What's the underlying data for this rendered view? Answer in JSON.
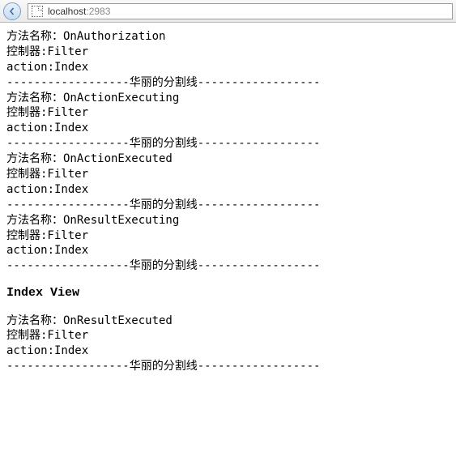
{
  "address": {
    "host": "localhost",
    "port": ":2983"
  },
  "labels": {
    "method_name": "方法名称：",
    "controller": "控制器:",
    "action": "action:",
    "divider": "------------------华丽的分割线------------------"
  },
  "blocks": [
    {
      "method": "OnAuthorization",
      "controller": "Filter",
      "action": "Index"
    },
    {
      "method": "OnActionExecuting",
      "controller": "Filter",
      "action": "Index"
    },
    {
      "method": "OnActionExecuted",
      "controller": "Filter",
      "action": "Index"
    },
    {
      "method": "OnResultExecuting",
      "controller": "Filter",
      "action": "Index"
    }
  ],
  "heading": "Index View",
  "blocks_after": [
    {
      "method": "OnResultExecuted",
      "controller": "Filter",
      "action": "Index"
    }
  ]
}
